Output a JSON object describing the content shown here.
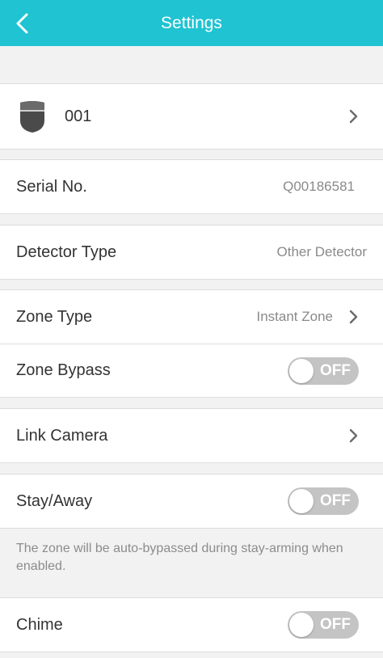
{
  "header": {
    "title": "Settings"
  },
  "device": {
    "name": "001"
  },
  "serial": {
    "label": "Serial No.",
    "value": "Q00186581"
  },
  "detector_type": {
    "label": "Detector Type",
    "value": "Other Detector"
  },
  "zone_type": {
    "label": "Zone Type",
    "value": "Instant Zone"
  },
  "zone_bypass": {
    "label": "Zone Bypass",
    "state": "OFF"
  },
  "link_camera": {
    "label": "Link Camera"
  },
  "stay_away": {
    "label": "Stay/Away",
    "state": "OFF",
    "note": "The zone will be auto-bypassed during stay-arming when enabled."
  },
  "chime": {
    "label": "Chime",
    "state": "OFF"
  },
  "colors": {
    "header": "#1fc3d2",
    "toggle_off": "#c4c4c4",
    "background": "#f2f2f2"
  },
  "icons": {
    "back": "chevron-left-icon",
    "chevron": "chevron-right-icon",
    "device": "detector-device-icon"
  }
}
